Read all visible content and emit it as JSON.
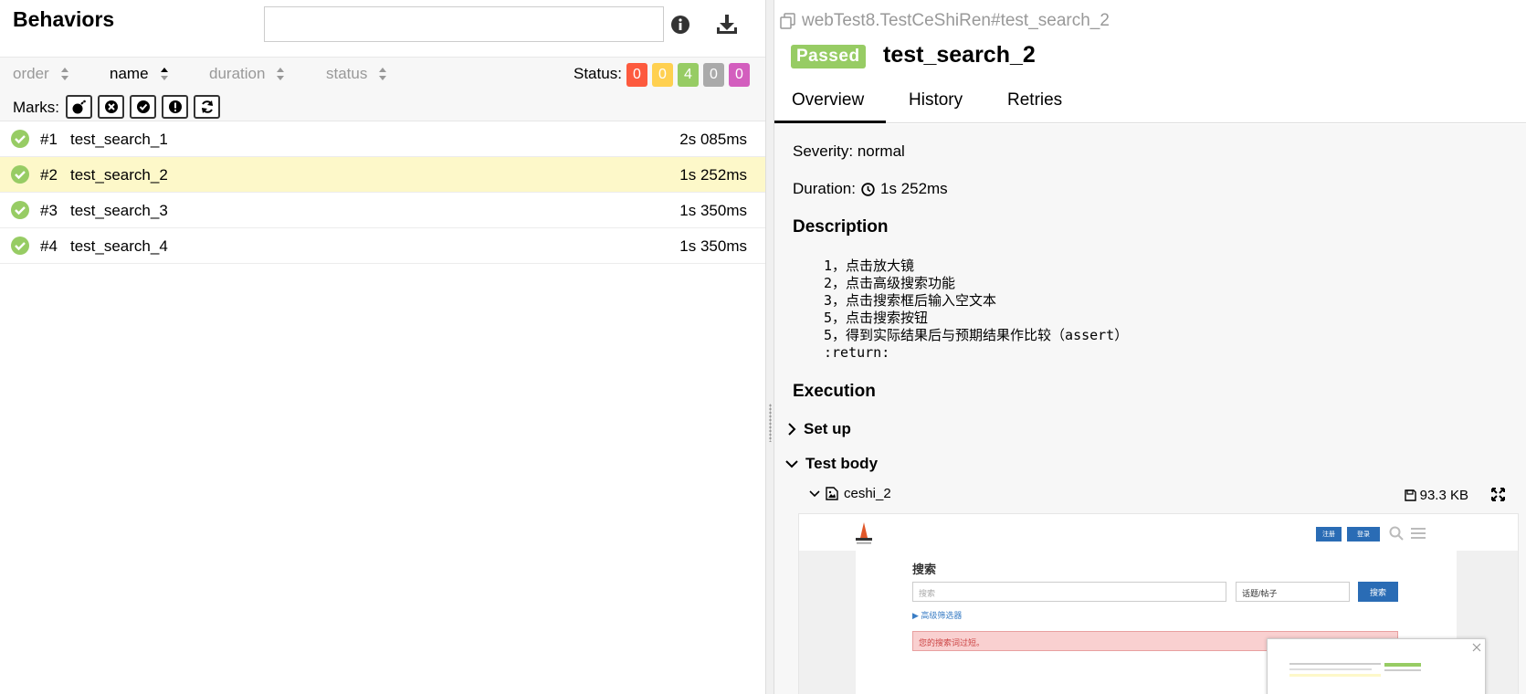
{
  "left": {
    "title": "Behaviors",
    "search_value": "",
    "icons": [
      "info-icon",
      "download-icon"
    ],
    "sort": {
      "order": "order",
      "name": "name",
      "duration": "duration",
      "status": "status",
      "active": "name"
    },
    "status_label": "Status:",
    "status_counts": [
      {
        "value": "0",
        "color": "#fd5a3e"
      },
      {
        "value": "0",
        "color": "#ffd050"
      },
      {
        "value": "4",
        "color": "#97cc64"
      },
      {
        "value": "0",
        "color": "#aaaaaa"
      },
      {
        "value": "0",
        "color": "#d35ebe"
      }
    ],
    "marks_label": "Marks:",
    "marks": [
      "bomb-icon",
      "times-circle-icon",
      "check-circle-icon",
      "exclamation-circle-icon",
      "refresh-icon"
    ],
    "tests": [
      {
        "num": "#1",
        "name": "test_search_1",
        "duration": "2s 085ms",
        "selected": false
      },
      {
        "num": "#2",
        "name": "test_search_2",
        "duration": "1s 252ms",
        "selected": true
      },
      {
        "num": "#3",
        "name": "test_search_3",
        "duration": "1s 350ms",
        "selected": false
      },
      {
        "num": "#4",
        "name": "test_search_4",
        "duration": "1s 350ms",
        "selected": false
      }
    ]
  },
  "right": {
    "path": "webTest8.TestCeShiRen#test_search_2",
    "status_badge": "Passed",
    "test_title": "test_search_2",
    "tabs": [
      "Overview",
      "History",
      "Retries"
    ],
    "active_tab": "Overview",
    "severity": "Severity: normal",
    "duration_label": "Duration:",
    "duration_value": "1s 252ms",
    "description_heading": "Description",
    "description_text": "1，点击放大镜\n2，点击高级搜索功能\n3，点击搜索框后输入空文本\n5，点击搜索按钮\n5，得到实际结果后与预期结果作比较（assert）\n:return:",
    "execution_heading": "Execution",
    "setup_label": "Set up",
    "testbody_label": "Test body",
    "attachment": {
      "name": "ceshi_2",
      "size": "93.3 KB"
    },
    "screenshot": {
      "register_btn": "注册",
      "login_btn": "登录",
      "page_title": "搜索",
      "search_placeholder": "搜索",
      "select_value": "话题/帖子",
      "search_btn": "搜索",
      "advanced_filter": "▶ 高级筛选器",
      "alert": "您的搜索词过短。"
    }
  }
}
